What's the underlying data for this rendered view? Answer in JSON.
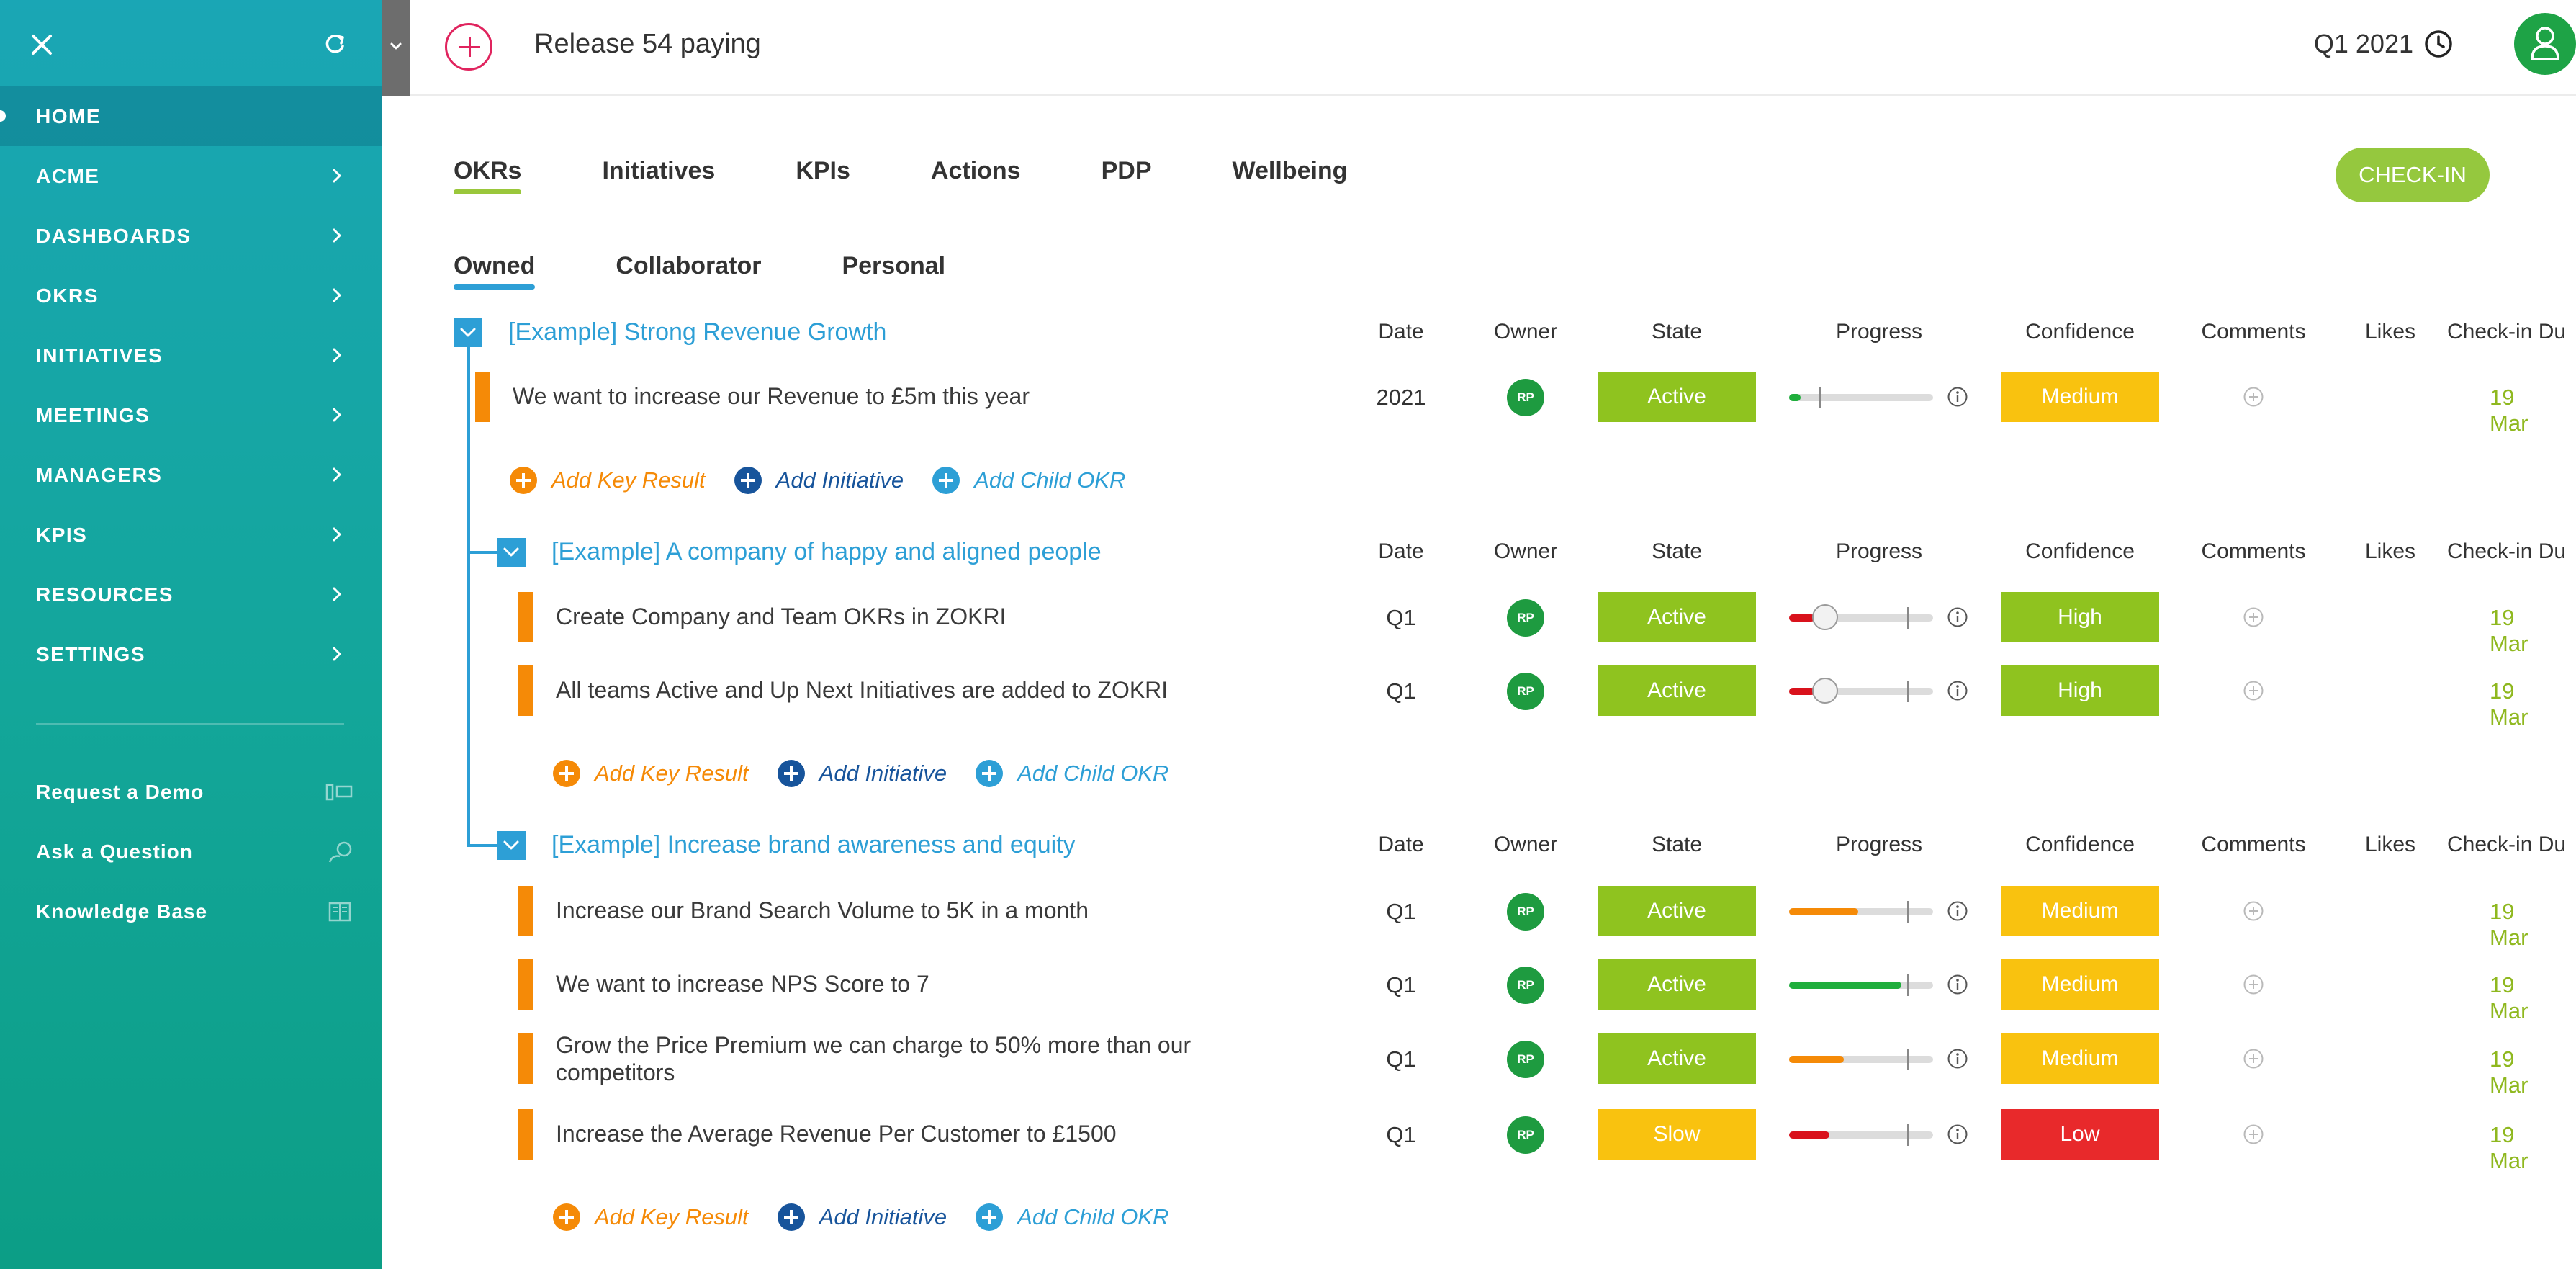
{
  "sidebar": {
    "items": [
      {
        "label": "HOME"
      },
      {
        "label": "ACME"
      },
      {
        "label": "DASHBOARDS"
      },
      {
        "label": "OKRS"
      },
      {
        "label": "INITIATIVES"
      },
      {
        "label": "MEETINGS"
      },
      {
        "label": "MANAGERS"
      },
      {
        "label": "KPIS"
      },
      {
        "label": "RESOURCES"
      },
      {
        "label": "SETTINGS"
      }
    ],
    "links": [
      {
        "label": "Request a Demo",
        "icon": "demo-icon"
      },
      {
        "label": "Ask a Question",
        "icon": "question-icon"
      },
      {
        "label": "Knowledge Base",
        "icon": "book-icon"
      }
    ]
  },
  "header": {
    "title": "Release 54 paying",
    "period": "Q1 2021"
  },
  "tabs": [
    "OKRs",
    "Initiatives",
    "KPIs",
    "Actions",
    "PDP",
    "Wellbeing"
  ],
  "checkin_button": "CHECK-IN",
  "subtabs": [
    "Owned",
    "Collaborator",
    "Personal"
  ],
  "columns": {
    "date": "Date",
    "owner": "Owner",
    "state": "State",
    "progress": "Progress",
    "confidence": "Confidence",
    "comments": "Comments",
    "likes": "Likes",
    "checkin": "Check-in Du"
  },
  "add_actions": {
    "key_result": "Add Key Result",
    "initiative": "Add Initiative",
    "child_okr": "Add Child OKR"
  },
  "objectives": [
    {
      "title": "[Example] Strong Revenue Growth",
      "key_results": [
        {
          "text": "We want to increase our Revenue to £5m this year",
          "date": "2021",
          "owner": "RP",
          "state": "Active",
          "confidence": "Medium",
          "progress": 0.08,
          "progress_color": "#1fae3c",
          "checkin": "19 Mar"
        }
      ]
    },
    {
      "title": "[Example] A company of happy and aligned people",
      "key_results": [
        {
          "text": "Create Company and Team OKRs in ZOKRI",
          "date": "Q1",
          "owner": "RP",
          "state": "Active",
          "confidence": "High",
          "progress": 0.18,
          "progress_color": "#d9121c",
          "checkin": "19 Mar"
        },
        {
          "text": "All teams Active and Up Next Initiatives are added to ZOKRI",
          "date": "Q1",
          "owner": "RP",
          "state": "Active",
          "confidence": "High",
          "progress": 0.18,
          "progress_color": "#d9121c",
          "checkin": "19 Mar"
        }
      ]
    },
    {
      "title": "[Example] Increase brand awareness and equity",
      "key_results": [
        {
          "text": "Increase our Brand Search Volume to 5K in a month",
          "date": "Q1",
          "owner": "RP",
          "state": "Active",
          "confidence": "Medium",
          "progress": 0.48,
          "progress_color": "#f58a07",
          "checkin": "19 Mar"
        },
        {
          "text": "We want to increase NPS Score to 7",
          "date": "Q1",
          "owner": "RP",
          "state": "Active",
          "confidence": "Medium",
          "progress": 0.78,
          "progress_color": "#1fae3c",
          "checkin": "19 Mar"
        },
        {
          "text": "Grow the Price Premium we can charge to 50% more than our competitors",
          "date": "Q1",
          "owner": "RP",
          "state": "Active",
          "confidence": "Medium",
          "progress": 0.38,
          "progress_color": "#f58a07",
          "checkin": "19 Mar"
        },
        {
          "text": "Increase the Average Revenue Per Customer to £1500",
          "date": "Q1",
          "owner": "RP",
          "state": "Slow",
          "confidence": "Low",
          "progress": 0.28,
          "progress_color": "#d9121c",
          "checkin": "19 Mar"
        }
      ]
    }
  ]
}
